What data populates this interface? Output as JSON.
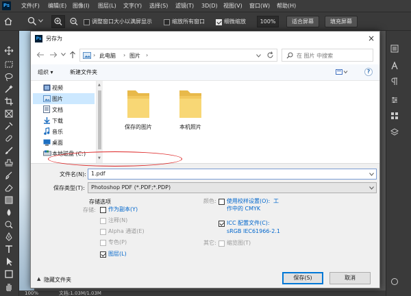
{
  "ps": {
    "logo": "Ps",
    "menu": [
      "文件(F)",
      "编辑(E)",
      "图像(I)",
      "图层(L)",
      "文字(Y)",
      "选择(S)",
      "滤镜(T)",
      "3D(D)",
      "视图(V)",
      "窗口(W)",
      "帮助(H)"
    ],
    "options": {
      "resize_windows_label": "调整窗口大小以满屏显示",
      "zoom_all_label": "缩放所有窗口",
      "scrubby_zoom_label": "细微缩放",
      "zoom_value": "100%",
      "fit_screen_label": "适合屏幕",
      "fill_screen_label": "填充屏幕"
    },
    "status": {
      "zoom": "100%",
      "doc": "文档:1.03M/1.03M"
    }
  },
  "dialog": {
    "title": "另存为",
    "logo": "Ps",
    "close_label": "×",
    "address": {
      "part1": "此电脑",
      "part2": "图片"
    },
    "search_placeholder": "在 图片 中搜索",
    "toolbar": {
      "organize_label": "组织",
      "new_folder_label": "新建文件夹"
    },
    "nav_items": [
      {
        "label": "视频"
      },
      {
        "label": "图片"
      },
      {
        "label": "文档"
      },
      {
        "label": "下载"
      },
      {
        "label": "音乐"
      },
      {
        "label": "桌面"
      },
      {
        "label": "本地磁盘 (C:)"
      }
    ],
    "folders": [
      {
        "label": "保存的图片"
      },
      {
        "label": "本机照片"
      }
    ],
    "filename_label": "文件名(N):",
    "filename_value": "1.pdf",
    "filetype_label": "保存类型(T):",
    "filetype_value": "Photoshop PDF (*.PDF;*.PDP)",
    "save_options_title": "存储选项",
    "save_label": "存储:",
    "options": {
      "as_copy": "作为副本(Y)",
      "annotations": "注释(N)",
      "alpha": "Alpha 通道(E)",
      "spot": "专色(P)",
      "layers": "图层(L)"
    },
    "color_label": "颜色:",
    "proof_setup_line1": "使用校样设置(O):",
    "proof_setup_work": "工",
    "proof_setup_line2": "作中的 CMYK",
    "icc_line1": "ICC 配置文件(C):",
    "icc_line2": "sRGB IEC61966-2.1",
    "other_label": "其它:",
    "thumbnail_label": "缩览图(T)",
    "hide_folders_label": "隐藏文件夹",
    "save_button": "保存(S)",
    "cancel_button": "取消"
  },
  "colors": {
    "accent": "#0078d7",
    "link": "#0066cc",
    "highlight_ellipse": "#dd2222",
    "folder": "#f4cc5a"
  }
}
